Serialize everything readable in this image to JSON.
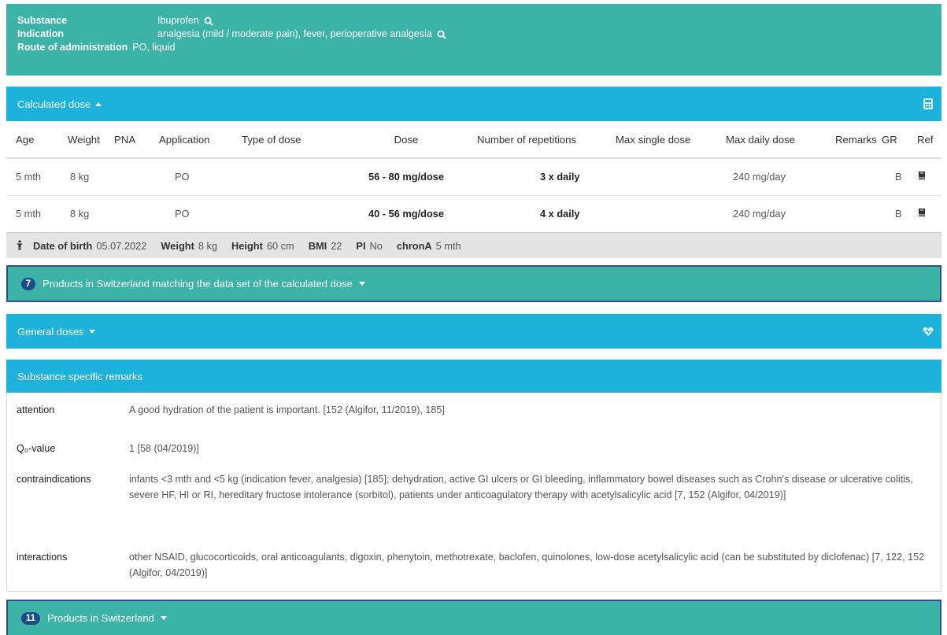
{
  "header": {
    "substance_label": "Substance",
    "substance_value": "Ibuprofen",
    "indication_label": "Indication",
    "indication_value": "analgesia (mild / moderate pain), fever, perioperative analgesia",
    "route_label": "Route of administration",
    "route_value": "PO, liquid"
  },
  "calculated": {
    "title": "Calculated dose",
    "columns": [
      "Age",
      "Weight",
      "PNA",
      "Application",
      "Type of dose",
      "Dose",
      "Number of repetitions",
      "Max single dose",
      "Max daily dose",
      "Remarks",
      "GR",
      "Ref"
    ],
    "rows": [
      {
        "age": "5 mth",
        "weight": "8 kg",
        "pna": "",
        "application": "PO",
        "type": "",
        "dose": "56 - 80 mg/dose",
        "repetitions": "3 x daily",
        "max_single": "",
        "max_daily": "240 mg/day",
        "remarks": "",
        "gr": "B"
      },
      {
        "age": "5 mth",
        "weight": "8 kg",
        "pna": "",
        "application": "PO",
        "type": "",
        "dose": "40 - 56 mg/dose",
        "repetitions": "4 x daily",
        "max_single": "",
        "max_daily": "240 mg/day",
        "remarks": "",
        "gr": "B"
      }
    ]
  },
  "patient": {
    "dob_label": "Date of birth",
    "dob_value": "05.07.2022",
    "weight_label": "Weight",
    "weight_value": "8 kg",
    "height_label": "Height",
    "height_value": "60 cm",
    "bmi_label": "BMI",
    "bmi_value": "22",
    "pi_label": "PI",
    "pi_value": "No",
    "chrona_label": "chronA",
    "chrona_value": "5 mth"
  },
  "products_match": {
    "count": "7",
    "label": "Products in Switzerland matching the data set of the calculated dose"
  },
  "general_doses": {
    "title": "General doses"
  },
  "remarks": {
    "title": "Substance specific remarks",
    "items": [
      {
        "label": "attention",
        "text": "A good hydration of the patient is important. [152 (Algifor, 11/2019), 185]"
      },
      {
        "label": "Q₀-value",
        "text": "1 [58 (04/2019)]"
      },
      {
        "label": "contraindications",
        "text": "infants <3 mth and <5 kg (indication fever, analgesia) [185]; dehydration, active GI ulcers or GI bleeding, inflammatory bowel diseases such as Crohn's disease or ulcerative colitis, severe HF, HI or RI, hereditary fructose intolerance (sorbitol), patients under anticoagulatory therapy with acetylsalicylic acid [7, 152 (Algifor, 04/2019)]"
      },
      {
        "label": "interactions",
        "text": "other NSAID, glucocorticoids, oral anticoagulants, digoxin, phenytoin, methotrexate, baclofen, quinolones, low-dose acetylsalicylic acid (can be substituted by diclofenac) [7, 122, 152 (Algifor, 04/2019)]"
      }
    ]
  },
  "products_all": {
    "count": "11",
    "label": "Products in Switzerland"
  },
  "colors": {
    "teal": "#3bb3a7",
    "blue": "#1cb2dc",
    "badge": "#1f4a8a"
  },
  "icons": [
    "search-icon",
    "caret-up-icon",
    "calculator-icon",
    "book-icon",
    "person-icon",
    "caret-down-icon",
    "heart-pulse-icon"
  ]
}
